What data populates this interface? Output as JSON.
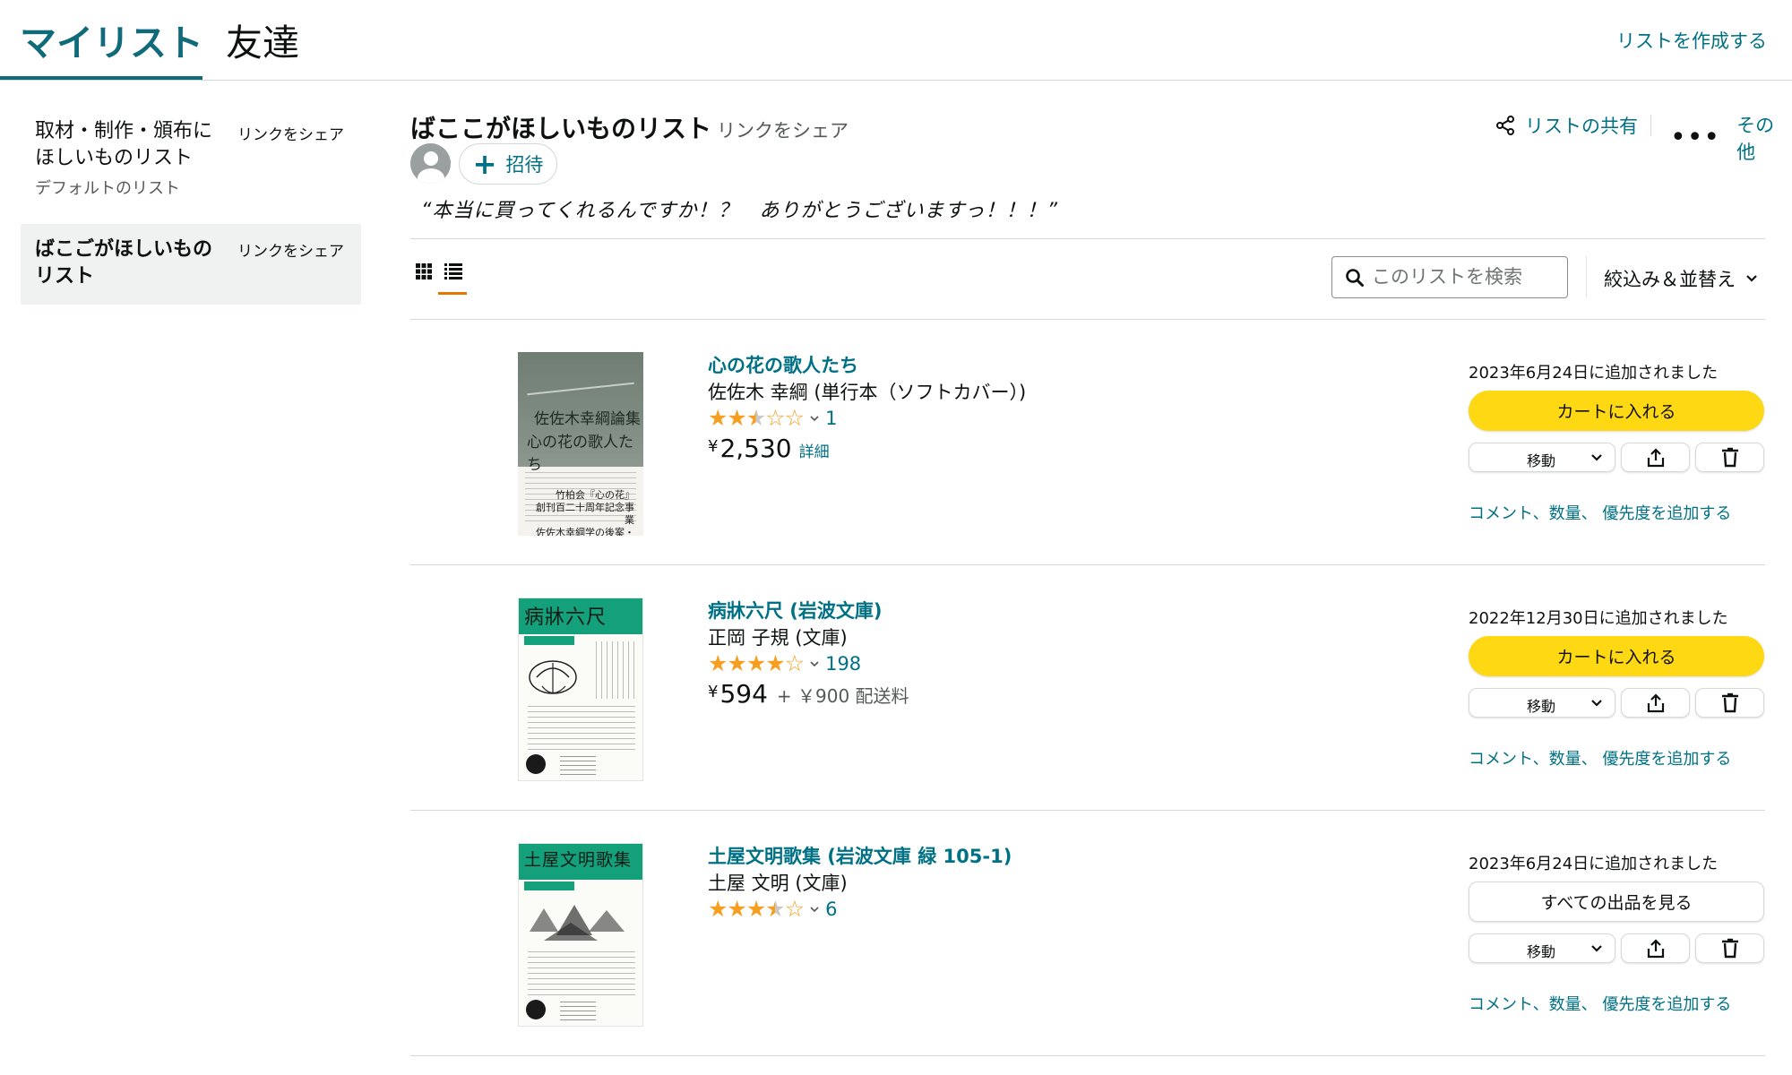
{
  "tabs": {
    "mylist": "マイリスト",
    "friends": "友達",
    "create_list": "リストを作成する"
  },
  "sidebar": {
    "items": [
      {
        "title": "取材・制作・頒布にほしいものリスト",
        "share": "リンクをシェア",
        "sub": "デフォルトのリスト",
        "selected": false
      },
      {
        "title": "ばこごがほしいものリスト",
        "share": "リンクをシェア",
        "selected": true
      }
    ]
  },
  "list": {
    "title": "ばここがほしいものリスト",
    "share_link": "リンクをシェア",
    "invite_label": "招待",
    "description": "“本当に買ってくれるんですか！？　ありがとうございますっ！！！”",
    "share_action": "リストの共有",
    "more_action": "その他"
  },
  "toolbar": {
    "search_placeholder": "このリストを検索",
    "filter_label": "絞込み＆並替え"
  },
  "items": [
    {
      "cover": {
        "line1": "佐佐木幸綱論集",
        "line2": "心の花の歌人たち",
        "block": "竹柏会『心の花』\n創刊百二十周年記念事業\n佐佐木幸綱学の後案・解説"
      },
      "title": "心の花の歌人たち",
      "author": "佐佐木 幸綱 (単行本（ソフトカバー）)",
      "rating": 2.5,
      "rating_count": "1",
      "yen": "¥",
      "price": "2,530",
      "detail": "詳細",
      "added": "2023年6月24日に追加されました",
      "primary_button": "カートに入れる",
      "primary_style": "cart",
      "move": "移動",
      "comment": "コメント、数量、 優先度を追加する"
    },
    {
      "cover": {
        "band": "病牀六尺"
      },
      "title": "病牀六尺 (岩波文庫)",
      "author": "正岡 子規 (文庫)",
      "rating": 4,
      "rating_count": "198",
      "yen": "¥",
      "price": "594",
      "shipping": "+ ￥900 配送料",
      "added": "2022年12月30日に追加されました",
      "primary_button": "カートに入れる",
      "primary_style": "cart",
      "move": "移動",
      "comment": "コメント、数量、 優先度を追加する"
    },
    {
      "cover": {
        "band": "土屋文明歌集"
      },
      "title": "土屋文明歌集 (岩波文庫 緑 105-1)",
      "author": "土屋 文明 (文庫)",
      "rating": 3.5,
      "rating_count": "6",
      "added": "2023年6月24日に追加されました",
      "primary_button": "すべての出品を見る",
      "primary_style": "outline",
      "move": "移動",
      "comment": "コメント、数量、 優先度を追加する"
    }
  ],
  "colors": {
    "accent": "#007185",
    "tab_active": "#0f6b7a",
    "cart_button": "#ffd814",
    "star": "#f69e1f",
    "view_underline": "#e77600"
  },
  "icons": [
    "share-icon",
    "more-dots-icon",
    "grid-view-icon",
    "list-view-icon",
    "search-icon",
    "chevron-down-icon",
    "upload-share-icon",
    "trash-icon",
    "plus-icon",
    "avatar-icon"
  ]
}
